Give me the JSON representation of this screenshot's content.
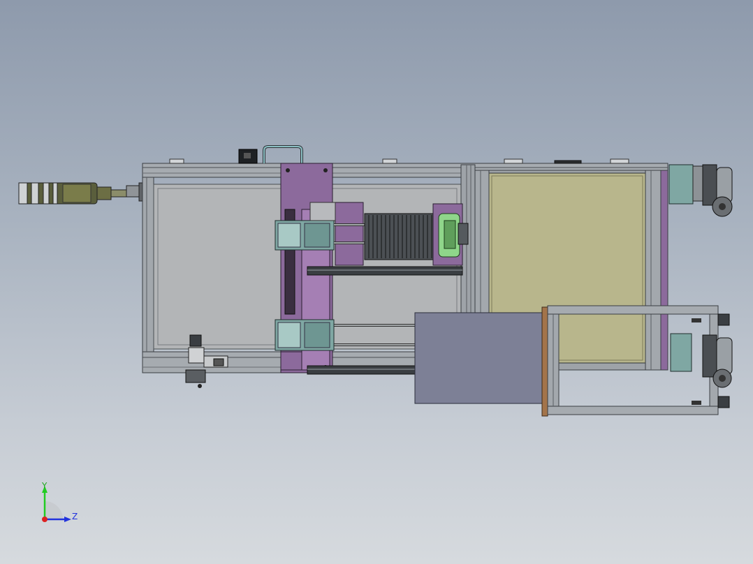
{
  "viewport": {
    "background_top": "#8e9aac",
    "background_bottom": "#d6dade"
  },
  "model": {
    "colors": {
      "frame_steel": "#9ea3a8",
      "frame_dark": "#5c6166",
      "panel_gray": "#b5b7b9",
      "panel_khaki": "#b8b68c",
      "purple_plate": "#8c6a9c",
      "teal_block": "#7fa7a3",
      "cover_blue_gray": "#7d8096",
      "copper_edge": "#a3744a",
      "green_part": "#8fd68a",
      "heatsink": "#4c5054"
    }
  },
  "triad": {
    "y_label": "Y",
    "z_label": "Z",
    "y_color": "#22cc22",
    "z_color": "#2233dd",
    "x_color": "#dd2222"
  }
}
